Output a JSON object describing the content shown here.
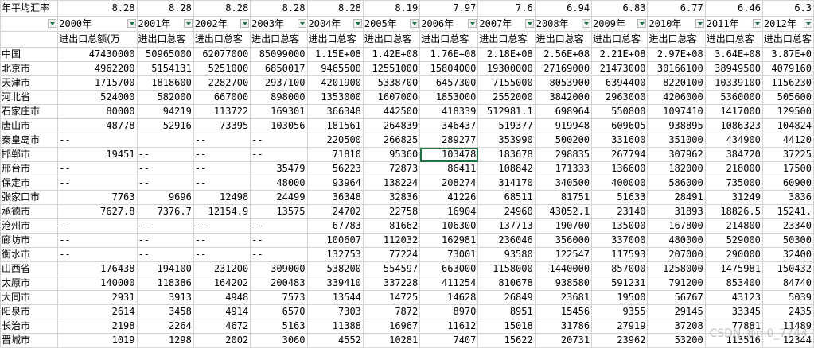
{
  "sheet": {
    "title_cell": "年平均汇率",
    "rates": [
      "8.28",
      "8.28",
      "8.28",
      "8.28",
      "8.28",
      "8.19",
      "7.97",
      "7.6",
      "6.94",
      "6.83",
      "6.77",
      "6.46",
      "6.3"
    ],
    "years": [
      "2000年",
      "2001年",
      "2002年",
      "2003年",
      "2004年",
      "2005年",
      "2006年",
      "2007年",
      "2008年",
      "2009年",
      "2010年",
      "2011年",
      "2012年"
    ],
    "metric_label": "进出口总额(万",
    "metric_labels": [
      "进出口总额(万",
      "进出口总客",
      "进出口总客",
      "进出口总客",
      "进出口总客",
      "进出口总客",
      "进出口总客",
      "进出口总客",
      "进出口总客",
      "进出口总客",
      "进出口总客",
      "进出口总客",
      "进出口总客"
    ],
    "rows": [
      {
        "name": "中国",
        "v": [
          "47430000",
          "50965000",
          "62077000",
          "85099000",
          "1.15E+08",
          "1.42E+08",
          "1.76E+08",
          "2.18E+08",
          "2.56E+08",
          "2.21E+08",
          "2.97E+08",
          "3.64E+08",
          "3.87E+0"
        ]
      },
      {
        "name": "北京市",
        "v": [
          "4962200",
          "5154131",
          "5251000",
          "6850017",
          "9465500",
          "12551000",
          "15804000",
          "19300000",
          "27169000",
          "21473000",
          "30166100",
          "38949500",
          "4079160"
        ]
      },
      {
        "name": "天津市",
        "v": [
          "1715700",
          "1818600",
          "2282700",
          "2937100",
          "4201900",
          "5338700",
          "6457300",
          "7155000",
          "8053900",
          "6394400",
          "8220100",
          "10339100",
          "1156230"
        ]
      },
      {
        "name": "河北省",
        "v": [
          "524000",
          "582000",
          "667000",
          "898000",
          "1353000",
          "1607000",
          "1853000",
          "2552000",
          "3842000",
          "2963000",
          "4206000",
          "5360000",
          "505600"
        ]
      },
      {
        "name": "石家庄市",
        "v": [
          "80000",
          "94219",
          "113722",
          "169301",
          "366348",
          "442500",
          "418339",
          "512981.1",
          "698964",
          "550800",
          "1097410",
          "1417000",
          "129500"
        ]
      },
      {
        "name": "唐山市",
        "v": [
          "48778",
          "52916",
          "73395",
          "103056",
          "181561",
          "264839",
          "346437",
          "519377",
          "919948",
          "609605",
          "938895",
          "1086323",
          "104824"
        ]
      },
      {
        "name": "秦皇岛市",
        "v": [
          "--",
          "",
          "--",
          "--",
          "220500",
          "266825",
          "289277",
          "353990",
          "500200",
          "331600",
          "351000",
          "434900",
          "44120"
        ]
      },
      {
        "name": "邯郸市",
        "v": [
          "19451",
          "--",
          "--",
          "--",
          "71810",
          "95360",
          "103478",
          "183678",
          "298835",
          "267794",
          "307962",
          "384720",
          "37225"
        ]
      },
      {
        "name": "邢台市",
        "v": [
          "--",
          "--",
          "--",
          "35479",
          "56223",
          "72873",
          "86411",
          "108842",
          "171333",
          "136600",
          "182000",
          "218000",
          "17500"
        ]
      },
      {
        "name": "保定市",
        "v": [
          "--",
          "--",
          "--",
          "48000",
          "93964",
          "138224",
          "208274",
          "314170",
          "340500",
          "400000",
          "586000",
          "735000",
          "60900"
        ]
      },
      {
        "name": "张家口市",
        "v": [
          "7763",
          "9696",
          "12498",
          "24499",
          "36348",
          "32836",
          "41226",
          "68511",
          "81751",
          "51633",
          "28491",
          "31249",
          "3836"
        ]
      },
      {
        "name": "承德市",
        "v": [
          "7627.8",
          "7376.7",
          "12154.9",
          "13575",
          "24702",
          "22758",
          "16904",
          "24960",
          "43052.1",
          "23140",
          "31893",
          "18826.5",
          "15241."
        ]
      },
      {
        "name": "沧州市",
        "v": [
          "--",
          "--",
          "--",
          "--",
          "67783",
          "81662",
          "106300",
          "137713",
          "190700",
          "135000",
          "167800",
          "214800",
          "23340"
        ]
      },
      {
        "name": "廊坊市",
        "v": [
          "--",
          "--",
          "--",
          "--",
          "100607",
          "112032",
          "162981",
          "236046",
          "356000",
          "337000",
          "480000",
          "529000",
          "50300"
        ]
      },
      {
        "name": "衡水市",
        "v": [
          "--",
          "--",
          "--",
          "--",
          "132753",
          "77224",
          "73001",
          "93580",
          "122547",
          "117593",
          "207000",
          "290000",
          "32400"
        ]
      },
      {
        "name": "山西省",
        "v": [
          "176438",
          "194100",
          "231200",
          "309000",
          "538200",
          "554597",
          "663000",
          "1158000",
          "1440000",
          "857000",
          "1258000",
          "1475981",
          "150432"
        ]
      },
      {
        "name": "太原市",
        "v": [
          "140000",
          "118386",
          "164202",
          "200483",
          "339410",
          "337228",
          "411254",
          "810678",
          "938580",
          "591231",
          "791200",
          "853400",
          "84740"
        ]
      },
      {
        "name": "大同市",
        "v": [
          "2931",
          "3913",
          "4948",
          "7573",
          "13544",
          "14725",
          "14628",
          "26849",
          "23681",
          "19500",
          "56767",
          "43123",
          "5039"
        ]
      },
      {
        "name": "阳泉市",
        "v": [
          "2614",
          "3458",
          "4914",
          "6570",
          "7303",
          "7872",
          "8970",
          "8951",
          "15456",
          "9355",
          "29145",
          "33345",
          "2435"
        ]
      },
      {
        "name": "长治市",
        "v": [
          "2198",
          "2264",
          "4672",
          "5163",
          "11388",
          "16967",
          "11612",
          "15018",
          "31786",
          "27919",
          "37208",
          "77881",
          "11489"
        ]
      },
      {
        "name": "晋城市",
        "v": [
          "1019",
          "1298",
          "2002",
          "3060",
          "4552",
          "10281",
          "7407",
          "15622",
          "20731",
          "23962",
          "53200",
          "113516",
          "12344"
        ]
      }
    ],
    "selected": {
      "row": "邯郸市",
      "year": "2006年"
    },
    "watermark": "CSDN @m0_7744"
  },
  "colors": {
    "grid": "#d4d4d4",
    "selection": "#217346",
    "watermark": "#bdbdbd"
  }
}
